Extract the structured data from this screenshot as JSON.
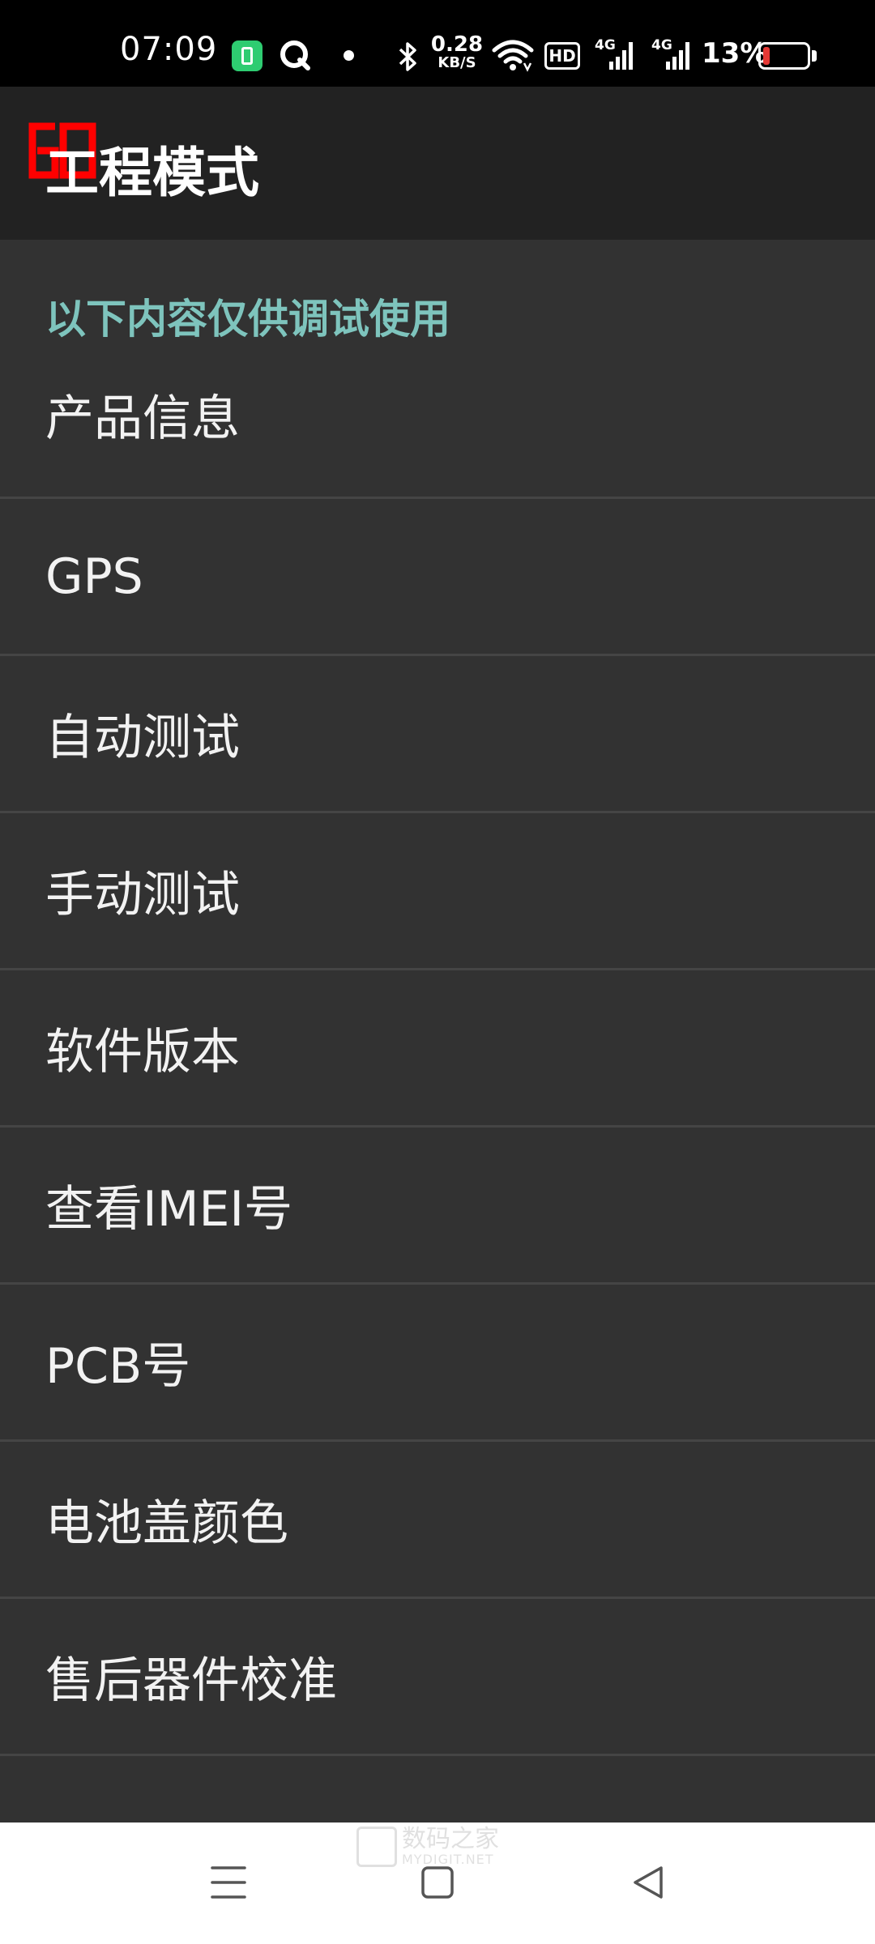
{
  "status_bar": {
    "time": "07:09",
    "net_speed_value": "0.28",
    "net_speed_unit": "KB/S",
    "hd_label": "HD",
    "network_1": "4G",
    "network_2": "4G",
    "battery_percent": "13%",
    "battery_level": 0.13,
    "battery_color": "#e53935",
    "icons": [
      "battery-saver-app-icon",
      "q-app-icon",
      "notification-dot-icon",
      "bluetooth-icon",
      "wifi-icon",
      "hd-voice-icon",
      "signal-icon",
      "signal-icon",
      "battery-icon"
    ]
  },
  "app_bar": {
    "title": "工程模式",
    "badge_color": "#ff0000"
  },
  "section": {
    "header": "以下内容仅供调试使用",
    "header_color": "#7ec4bd"
  },
  "menu": {
    "items": [
      {
        "label": "产品信息"
      },
      {
        "label": "GPS"
      },
      {
        "label": "自动测试"
      },
      {
        "label": "手动测试"
      },
      {
        "label": "软件版本"
      },
      {
        "label": "查看IMEI号"
      },
      {
        "label": "PCB号"
      },
      {
        "label": "电池盖颜色"
      },
      {
        "label": "售后器件校准"
      }
    ]
  },
  "nav_bar": {
    "buttons": [
      "menu-icon",
      "home-icon",
      "back-icon"
    ],
    "watermark_cn": "数码之家",
    "watermark_en": "MYDIGIT.NET"
  }
}
